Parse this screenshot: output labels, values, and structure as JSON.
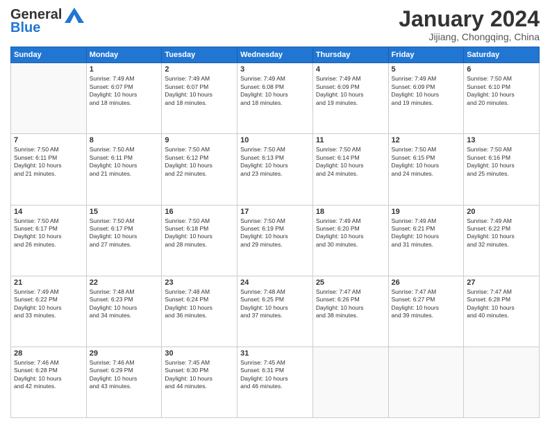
{
  "header": {
    "logo_general": "General",
    "logo_blue": "Blue",
    "month": "January 2024",
    "location": "Jijiang, Chongqing, China"
  },
  "days_of_week": [
    "Sunday",
    "Monday",
    "Tuesday",
    "Wednesday",
    "Thursday",
    "Friday",
    "Saturday"
  ],
  "weeks": [
    [
      {
        "num": "",
        "info": ""
      },
      {
        "num": "1",
        "info": "Sunrise: 7:49 AM\nSunset: 6:07 PM\nDaylight: 10 hours\nand 18 minutes."
      },
      {
        "num": "2",
        "info": "Sunrise: 7:49 AM\nSunset: 6:07 PM\nDaylight: 10 hours\nand 18 minutes."
      },
      {
        "num": "3",
        "info": "Sunrise: 7:49 AM\nSunset: 6:08 PM\nDaylight: 10 hours\nand 18 minutes."
      },
      {
        "num": "4",
        "info": "Sunrise: 7:49 AM\nSunset: 6:09 PM\nDaylight: 10 hours\nand 19 minutes."
      },
      {
        "num": "5",
        "info": "Sunrise: 7:49 AM\nSunset: 6:09 PM\nDaylight: 10 hours\nand 19 minutes."
      },
      {
        "num": "6",
        "info": "Sunrise: 7:50 AM\nSunset: 6:10 PM\nDaylight: 10 hours\nand 20 minutes."
      }
    ],
    [
      {
        "num": "7",
        "info": "Sunrise: 7:50 AM\nSunset: 6:11 PM\nDaylight: 10 hours\nand 21 minutes."
      },
      {
        "num": "8",
        "info": "Sunrise: 7:50 AM\nSunset: 6:11 PM\nDaylight: 10 hours\nand 21 minutes."
      },
      {
        "num": "9",
        "info": "Sunrise: 7:50 AM\nSunset: 6:12 PM\nDaylight: 10 hours\nand 22 minutes."
      },
      {
        "num": "10",
        "info": "Sunrise: 7:50 AM\nSunset: 6:13 PM\nDaylight: 10 hours\nand 23 minutes."
      },
      {
        "num": "11",
        "info": "Sunrise: 7:50 AM\nSunset: 6:14 PM\nDaylight: 10 hours\nand 24 minutes."
      },
      {
        "num": "12",
        "info": "Sunrise: 7:50 AM\nSunset: 6:15 PM\nDaylight: 10 hours\nand 24 minutes."
      },
      {
        "num": "13",
        "info": "Sunrise: 7:50 AM\nSunset: 6:16 PM\nDaylight: 10 hours\nand 25 minutes."
      }
    ],
    [
      {
        "num": "14",
        "info": "Sunrise: 7:50 AM\nSunset: 6:17 PM\nDaylight: 10 hours\nand 26 minutes."
      },
      {
        "num": "15",
        "info": "Sunrise: 7:50 AM\nSunset: 6:17 PM\nDaylight: 10 hours\nand 27 minutes."
      },
      {
        "num": "16",
        "info": "Sunrise: 7:50 AM\nSunset: 6:18 PM\nDaylight: 10 hours\nand 28 minutes."
      },
      {
        "num": "17",
        "info": "Sunrise: 7:50 AM\nSunset: 6:19 PM\nDaylight: 10 hours\nand 29 minutes."
      },
      {
        "num": "18",
        "info": "Sunrise: 7:49 AM\nSunset: 6:20 PM\nDaylight: 10 hours\nand 30 minutes."
      },
      {
        "num": "19",
        "info": "Sunrise: 7:49 AM\nSunset: 6:21 PM\nDaylight: 10 hours\nand 31 minutes."
      },
      {
        "num": "20",
        "info": "Sunrise: 7:49 AM\nSunset: 6:22 PM\nDaylight: 10 hours\nand 32 minutes."
      }
    ],
    [
      {
        "num": "21",
        "info": "Sunrise: 7:49 AM\nSunset: 6:22 PM\nDaylight: 10 hours\nand 33 minutes."
      },
      {
        "num": "22",
        "info": "Sunrise: 7:48 AM\nSunset: 6:23 PM\nDaylight: 10 hours\nand 34 minutes."
      },
      {
        "num": "23",
        "info": "Sunrise: 7:48 AM\nSunset: 6:24 PM\nDaylight: 10 hours\nand 36 minutes."
      },
      {
        "num": "24",
        "info": "Sunrise: 7:48 AM\nSunset: 6:25 PM\nDaylight: 10 hours\nand 37 minutes."
      },
      {
        "num": "25",
        "info": "Sunrise: 7:47 AM\nSunset: 6:26 PM\nDaylight: 10 hours\nand 38 minutes."
      },
      {
        "num": "26",
        "info": "Sunrise: 7:47 AM\nSunset: 6:27 PM\nDaylight: 10 hours\nand 39 minutes."
      },
      {
        "num": "27",
        "info": "Sunrise: 7:47 AM\nSunset: 6:28 PM\nDaylight: 10 hours\nand 40 minutes."
      }
    ],
    [
      {
        "num": "28",
        "info": "Sunrise: 7:46 AM\nSunset: 6:28 PM\nDaylight: 10 hours\nand 42 minutes."
      },
      {
        "num": "29",
        "info": "Sunrise: 7:46 AM\nSunset: 6:29 PM\nDaylight: 10 hours\nand 43 minutes."
      },
      {
        "num": "30",
        "info": "Sunrise: 7:45 AM\nSunset: 6:30 PM\nDaylight: 10 hours\nand 44 minutes."
      },
      {
        "num": "31",
        "info": "Sunrise: 7:45 AM\nSunset: 6:31 PM\nDaylight: 10 hours\nand 46 minutes."
      },
      {
        "num": "",
        "info": ""
      },
      {
        "num": "",
        "info": ""
      },
      {
        "num": "",
        "info": ""
      }
    ]
  ]
}
